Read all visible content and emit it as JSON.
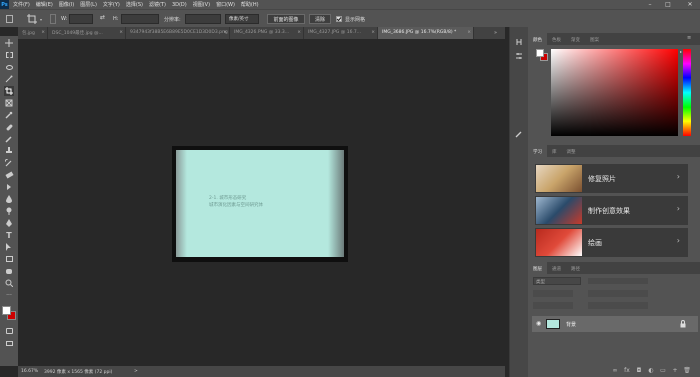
{
  "app": {
    "logo": "Ps"
  },
  "menu": [
    "文件(F)",
    "编辑(E)",
    "图像(I)",
    "图层(L)",
    "文字(Y)",
    "选择(S)",
    "滤镜(T)",
    "3D(D)",
    "视图(V)",
    "窗口(W)",
    "帮助(H)"
  ],
  "window_controls": {
    "minimize": "–",
    "maximize": "□",
    "close": "✕"
  },
  "options": {
    "w_label": "W:",
    "swap": "⇄",
    "h_label": "H:",
    "resolution_label": "分辨率:",
    "unit_select": "像素/英寸",
    "front_image_button": "前面的图像",
    "clear_button": "清除",
    "show_grid_label": "显示网格",
    "show_grid_checked": true
  },
  "tabs": [
    {
      "label": "包.jpg",
      "active": false
    },
    {
      "label": "DSC_1049最佳.jpg @...",
      "active": false
    },
    {
      "label": "9347943f38B5E6B89E5D0CE1D3D0D3.png",
      "active": false
    },
    {
      "label": "IMG_4326.PNG @ 33.3...",
      "active": false
    },
    {
      "label": "IMG_4327.JPG @ 16.7...",
      "active": false
    },
    {
      "label": "IMG_3686.JPG @ 16.7%(RGB/8) *",
      "active": true
    }
  ],
  "document": {
    "line1": "2-1. 城市形态研究",
    "line2": "城市演化因素与空间研究体"
  },
  "status": {
    "zoom": "16.67%",
    "size": "3992 像素 x 1565 像素 (72 ppi)",
    "arrow": ">"
  },
  "panels": {
    "color_tabs": [
      "颜色",
      "色板",
      "渐变",
      "图案"
    ],
    "learn_tabs": [
      "学习",
      "库",
      "调整"
    ],
    "learn_cards": [
      {
        "label": "修复照片",
        "thumb_color": "#c9a46a"
      },
      {
        "label": "制作创意效果",
        "thumb_color": "#2a4a6a"
      },
      {
        "label": "绘画",
        "thumb_color": "#c83a2a"
      }
    ],
    "layers_tabs": [
      "图层",
      "通道",
      "路径"
    ],
    "layers_search": "类型",
    "layer_row": {
      "name": "背景",
      "visible": true,
      "locked": true
    }
  },
  "colors": {
    "foreground": "#ffffff",
    "background": "#cc0000",
    "accent": "#31a8ff"
  },
  "icons": {
    "tools": [
      "move-icon",
      "marquee-icon",
      "lasso-icon",
      "magic-wand-icon",
      "crop-icon",
      "frame-icon",
      "eyedropper-icon",
      "healing-brush-icon",
      "brush-icon",
      "clone-stamp-icon",
      "history-brush-icon",
      "eraser-icon",
      "gradient-icon",
      "blur-icon",
      "dodge-icon",
      "pen-icon",
      "type-icon",
      "path-select-icon",
      "rectangle-icon",
      "hand-icon",
      "zoom-icon",
      "more-tools-icon"
    ]
  }
}
